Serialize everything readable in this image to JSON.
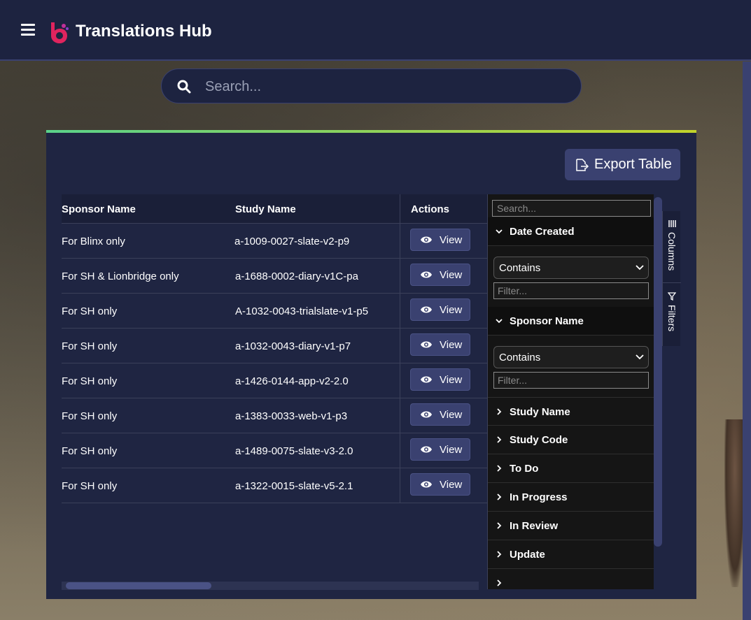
{
  "header": {
    "title": "Translations Hub"
  },
  "search": {
    "placeholder": "Search..."
  },
  "toolbar": {
    "export_label": "Export Table"
  },
  "table": {
    "columns": [
      "Sponsor Name",
      "Study Name",
      "Actions"
    ],
    "view_label": "View",
    "rows": [
      {
        "sponsor": "For Blinx only",
        "study": "a-1009-0027-slate-v2-p9"
      },
      {
        "sponsor": "For SH & Lionbridge only",
        "study": "a-1688-0002-diary-v1C-pa"
      },
      {
        "sponsor": "For SH only",
        "study": "A-1032-0043-trialslate-v1-p5"
      },
      {
        "sponsor": "For SH only",
        "study": "a-1032-0043-diary-v1-p7"
      },
      {
        "sponsor": "For SH only",
        "study": "a-1426-0144-app-v2-2.0"
      },
      {
        "sponsor": "For SH only",
        "study": "a-1383-0033-web-v1-p3"
      },
      {
        "sponsor": "For SH only",
        "study": "a-1489-0075-slate-v3-2.0"
      },
      {
        "sponsor": "For SH only",
        "study": "a-1322-0015-slate-v5-2.1"
      }
    ]
  },
  "tool_panel": {
    "search_placeholder": "Search...",
    "filter_placeholder": "Filter...",
    "operator": "Contains",
    "groups": [
      {
        "label": "Date Created",
        "expanded": true
      },
      {
        "label": "Sponsor Name",
        "expanded": true
      },
      {
        "label": "Study Name",
        "expanded": false
      },
      {
        "label": "Study Code",
        "expanded": false
      },
      {
        "label": "To Do",
        "expanded": false
      },
      {
        "label": "In Progress",
        "expanded": false
      },
      {
        "label": "In Review",
        "expanded": false
      },
      {
        "label": "Update",
        "expanded": false
      }
    ]
  },
  "side_tabs": {
    "columns": "Columns",
    "filters": "Filters"
  },
  "colors": {
    "header_bg": "#1d2340",
    "panel_bg": "#1f2542",
    "accent": "#3a4170",
    "tool_panel_bg": "#151515"
  }
}
